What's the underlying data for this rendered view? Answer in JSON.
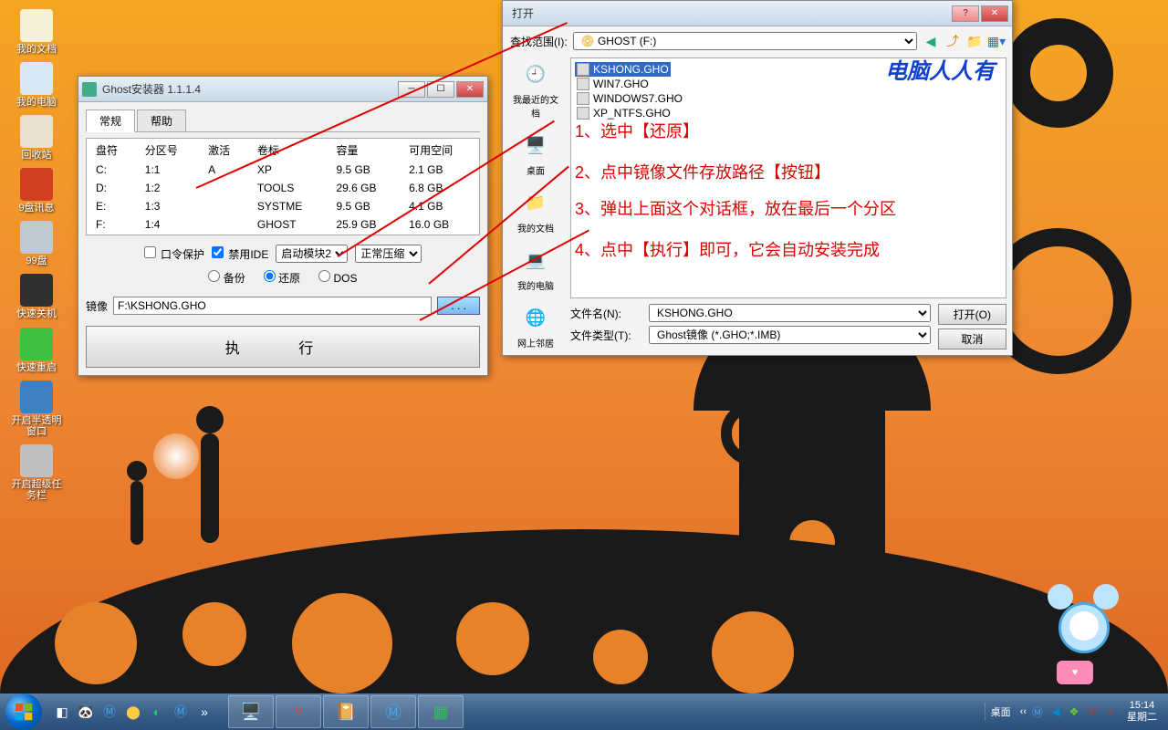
{
  "desktop": {
    "icons": [
      {
        "label": "我的文档",
        "color": "#f5f0d8"
      },
      {
        "label": "我的电脑",
        "color": "#d8e8f5"
      },
      {
        "label": "回收站",
        "color": "#e8e0d0"
      },
      {
        "label": "9盘讯息",
        "color": "#d04020"
      },
      {
        "label": "99盘",
        "color": "#c0c8d0"
      },
      {
        "label": "快速关机",
        "color": "#303030"
      },
      {
        "label": "快速重启",
        "color": "#40c040"
      },
      {
        "label": "开启半透明窗口",
        "color": "#4080c0"
      },
      {
        "label": "开启超级任务栏",
        "color": "#c0c0c0"
      }
    ]
  },
  "ghost_window": {
    "title": "Ghost安装器 1.1.1.4",
    "tabs": [
      "常规",
      "帮助"
    ],
    "columns": [
      "盘符",
      "分区号",
      "激活",
      "卷标",
      "容量",
      "可用空间"
    ],
    "rows": [
      {
        "drive": "C:",
        "part": "1:1",
        "active": "A",
        "label": "XP",
        "cap": "9.5 GB",
        "free": "2.1 GB"
      },
      {
        "drive": "D:",
        "part": "1:2",
        "active": "",
        "label": "TOOLS",
        "cap": "29.6 GB",
        "free": "6.8 GB"
      },
      {
        "drive": "E:",
        "part": "1:3",
        "active": "",
        "label": "SYSTME",
        "cap": "9.5 GB",
        "free": "4.1 GB"
      },
      {
        "drive": "F:",
        "part": "1:4",
        "active": "",
        "label": "GHOST",
        "cap": "25.9 GB",
        "free": "16.0 GB"
      }
    ],
    "check_password": "口令保护",
    "check_disable_ide": "禁用IDE",
    "select_boot": "启动模块2",
    "select_compress": "正常压缩",
    "radio_backup": "备份",
    "radio_restore": "还原",
    "radio_dos": "DOS",
    "image_label": "镜像",
    "image_path": "F:\\KSHONG.GHO",
    "browse": ". . .",
    "execute": "执    行"
  },
  "open_dialog": {
    "title": "打开",
    "lookin_label": "查找范围(I):",
    "lookin_value": "GHOST (F:)",
    "places": [
      "我最近的文档",
      "桌面",
      "我的文档",
      "我的电脑",
      "网上邻居"
    ],
    "files": [
      "KSHONG.GHO",
      "WIN7.GHO",
      "WINDOWS7.GHO",
      "XP_NTFS.GHO"
    ],
    "filename_label": "文件名(N):",
    "filename_value": "KSHONG.GHO",
    "filetype_label": "文件类型(T):",
    "filetype_value": "Ghost镜像 (*.GHO;*.IMB)",
    "open_btn": "打开(O)",
    "cancel_btn": "取消"
  },
  "watermark": "电脑人人有",
  "annotations": {
    "a1": "1、选中【还原】",
    "a2": "2、点中镜像文件存放路径【按钮】",
    "a3": "3、弹出上面这个对话框，放在最后一个分区",
    "a4": "4、点中【执行】即可，它会自动安装完成"
  },
  "taskbar": {
    "desktop_label": "桌面",
    "time": "15:14",
    "day": "星期二"
  }
}
